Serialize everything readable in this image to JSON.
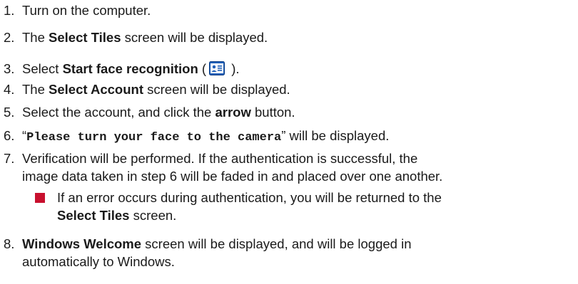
{
  "steps": [
    {
      "num": "1.",
      "text": "Turn on the computer."
    },
    {
      "num": "2.",
      "pre": "The ",
      "bold": "Select Tiles",
      "post": " screen will be displayed."
    },
    {
      "num": "3.",
      "pre": "Select ",
      "bold": "Start face recognition",
      "paren_open": " (",
      "paren_close": " )."
    },
    {
      "num": "4.",
      "pre": "The ",
      "bold": "Select Account",
      "post": " screen will be displayed."
    },
    {
      "num": "5.",
      "pre": "Select the account, and click the ",
      "bold": "arrow",
      "post": " button."
    },
    {
      "num": "6.",
      "quote_open": "“",
      "mono": "Please turn your face to the camera",
      "post": "” will be displayed."
    },
    {
      "num": "7.",
      "line1": "Verification will be performed. If the authentication is successful, the",
      "line2": "image data taken in step 6 will be faded in and placed over one another."
    },
    {
      "num": "8.",
      "bold": "Windows Welcome",
      "line1_post": " screen will be displayed, and will be logged in",
      "line2": "automatically to Windows."
    }
  ],
  "note": {
    "line1": "If an error occurs during authentication, you will be returned to the",
    "bold": "Select Tiles",
    "post": " screen."
  },
  "icon": {
    "name": "face-recognition-icon",
    "color": "#1f5fb8"
  },
  "bullet_color": "#c8102e"
}
